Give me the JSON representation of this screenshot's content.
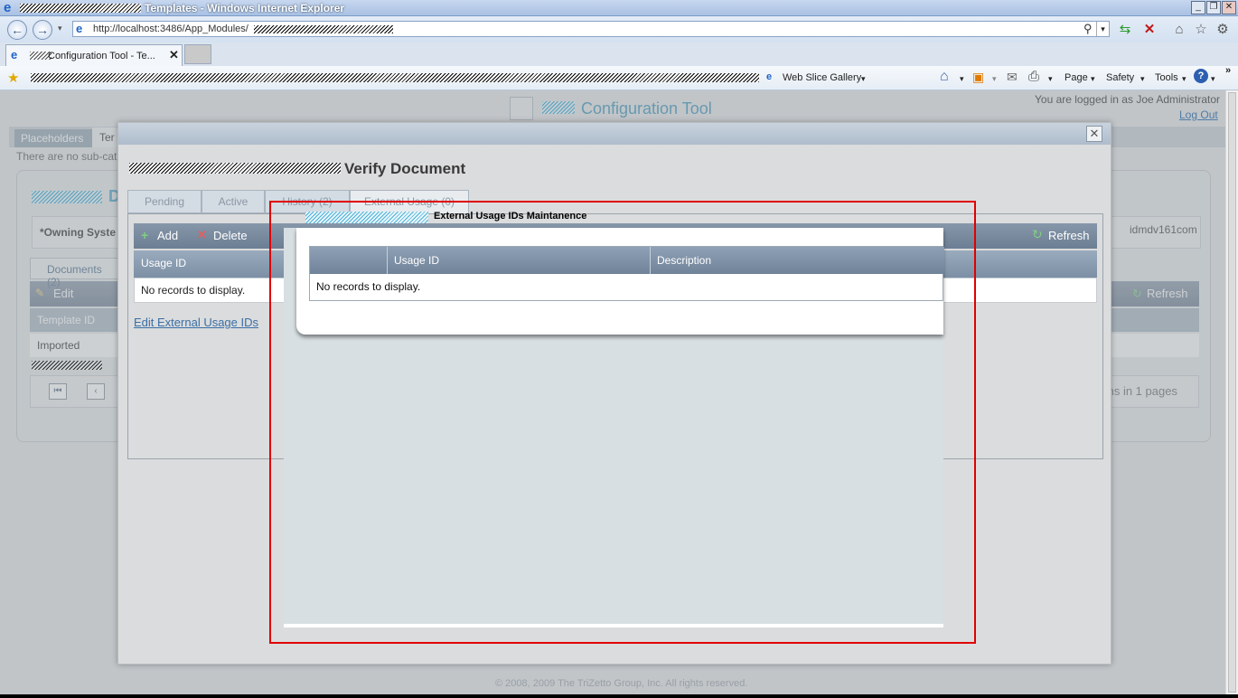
{
  "browser": {
    "window_title": "Templates - Windows Internet Explorer",
    "url_visible": "http://localhost:3486/App_Modules/",
    "tab_label": "Configuration Tool - Te...",
    "favorites": {
      "web_slice": "Web Slice Gallery"
    },
    "command_bar": {
      "page": "Page",
      "safety": "Safety",
      "tools": "Tools"
    }
  },
  "app": {
    "title": "Configuration Tool",
    "logged_in": "You are logged in as Joe Administrator",
    "logout": "Log Out",
    "tabs": [
      "Placeholders",
      "Ter"
    ],
    "subcat_text": "There are no sub-cat",
    "owning_label": "*Owning Syste",
    "server_text": "idmdv161com",
    "docs_tab": "Documents (2)",
    "edit_label": "Edit",
    "template_id_col": "Template ID",
    "imported_row": "Imported",
    "refresh_label": "Refresh",
    "paging_text": "ms in 1 pages",
    "footer": "© 2008, 2009 The TriZetto Group, Inc. All rights reserved."
  },
  "modal": {
    "title": "Verify Document",
    "tabs": [
      "Pending",
      "Active",
      "History (2)",
      "External Usage (0)"
    ],
    "toolbar": {
      "add": "Add",
      "delete": "Delete",
      "refresh": "Refresh"
    },
    "grid_header": "Usage ID",
    "no_records": "No records to display.",
    "edit_link": "Edit External Usage IDs"
  },
  "popup": {
    "title": "External Usage IDs Maintanence",
    "columns": [
      "",
      "Usage ID",
      "Description"
    ],
    "no_records": "No records to display."
  }
}
